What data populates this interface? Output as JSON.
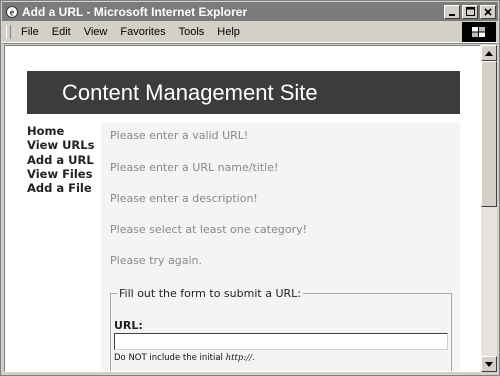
{
  "window": {
    "title": "Add a URL - Microsoft Internet Explorer",
    "buttons": [
      "minimize-icon",
      "maximize-icon",
      "close-icon"
    ]
  },
  "menu": {
    "items": [
      "File",
      "Edit",
      "View",
      "Favorites",
      "Tools",
      "Help"
    ]
  },
  "page": {
    "header_title": "Content Management Site",
    "nav": [
      "Home",
      "View URLs",
      "Add a URL",
      "View Files",
      "Add a File"
    ],
    "errors": [
      "Please enter a valid URL!",
      "Please enter a URL name/title!",
      "Please enter a description!",
      "Please select at least one category!",
      "Please try again."
    ],
    "form": {
      "legend": "Fill out the form to submit a URL:",
      "url_label": "URL:",
      "url_value": "",
      "note_prefix": "Do NOT include the initial ",
      "note_code": "http://",
      "note_suffix": "."
    }
  },
  "colors": {
    "header_bg": "#3c3c3c",
    "error_text": "#888888",
    "titlebar": "#7b7b7b"
  }
}
